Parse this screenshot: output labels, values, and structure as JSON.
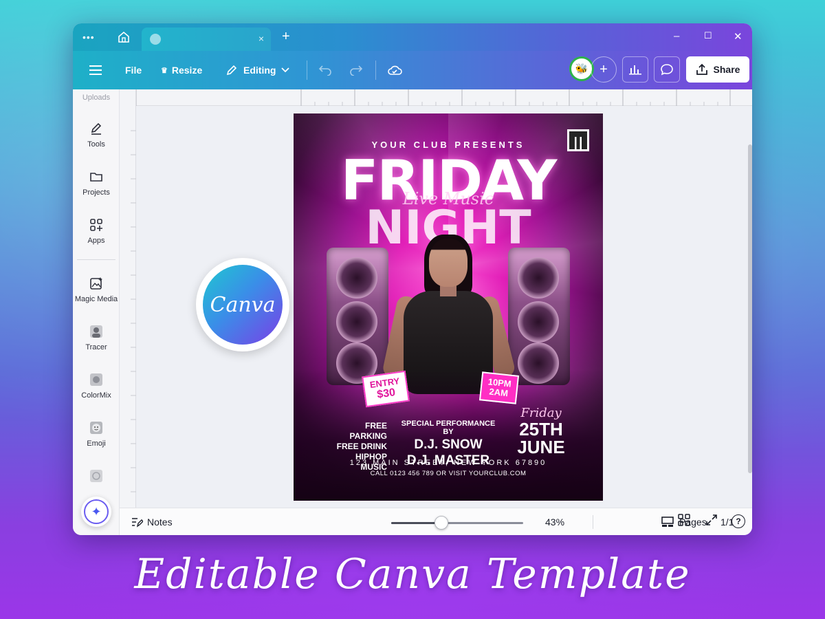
{
  "window": {
    "tab_close": "×",
    "new_tab": "+",
    "minimize": "–",
    "maximize": "☐",
    "close": "✕"
  },
  "toolbar": {
    "menu_icon": "hamburger-icon",
    "file_label": "File",
    "resize_label": "Resize",
    "editing_label": "Editing",
    "share_label": "Share"
  },
  "sidebar": {
    "partial_label": "Uploads",
    "items": [
      {
        "label": "Tools",
        "icon": "pencil-icon"
      },
      {
        "label": "Projects",
        "icon": "folder-icon"
      },
      {
        "label": "Apps",
        "icon": "apps-icon"
      },
      {
        "label": "Magic Media",
        "icon": "magic-media-icon"
      },
      {
        "label": "Tracer",
        "icon": "tracer-icon"
      },
      {
        "label": "ColorMix",
        "icon": "colormix-icon"
      },
      {
        "label": "Emoji",
        "icon": "emoji-icon"
      }
    ]
  },
  "badge": {
    "logo_text": "Canva"
  },
  "flyer": {
    "presents": "YOUR CLUB PRESENTS",
    "title_line1": "FRIDAY",
    "title_line2": "NIGHT",
    "script": "Live Music",
    "entry_tag": [
      "ENTRY",
      "$30"
    ],
    "time_tag": [
      "10PM",
      "2AM"
    ],
    "amenities": [
      "FREE PARKING",
      "FREE DRINK",
      "HIPHOP MUSIC"
    ],
    "special_label": "SPECIAL PERFORMANCE BY",
    "djs": [
      "D.J. SNOW",
      "D.J. MASTER"
    ],
    "day_script": "Friday",
    "date_line1": "25TH",
    "date_line2": "JUNE",
    "address": "123 MAIN STREET, NEW YORK 67890",
    "contact": "CALL 0123 456 789 OR VISIT  YOURCLUB.COM"
  },
  "bottombar": {
    "notes_label": "Notes",
    "zoom": "43%",
    "zoom_fraction": 0.38,
    "pages_label": "Pages",
    "page_count": "1/1",
    "help": "?"
  },
  "caption": "Editable Canva Template",
  "colors": {
    "accent": "#e0169c",
    "toolbar_start": "#1eb0c8",
    "toolbar_end": "#7a45dc"
  }
}
